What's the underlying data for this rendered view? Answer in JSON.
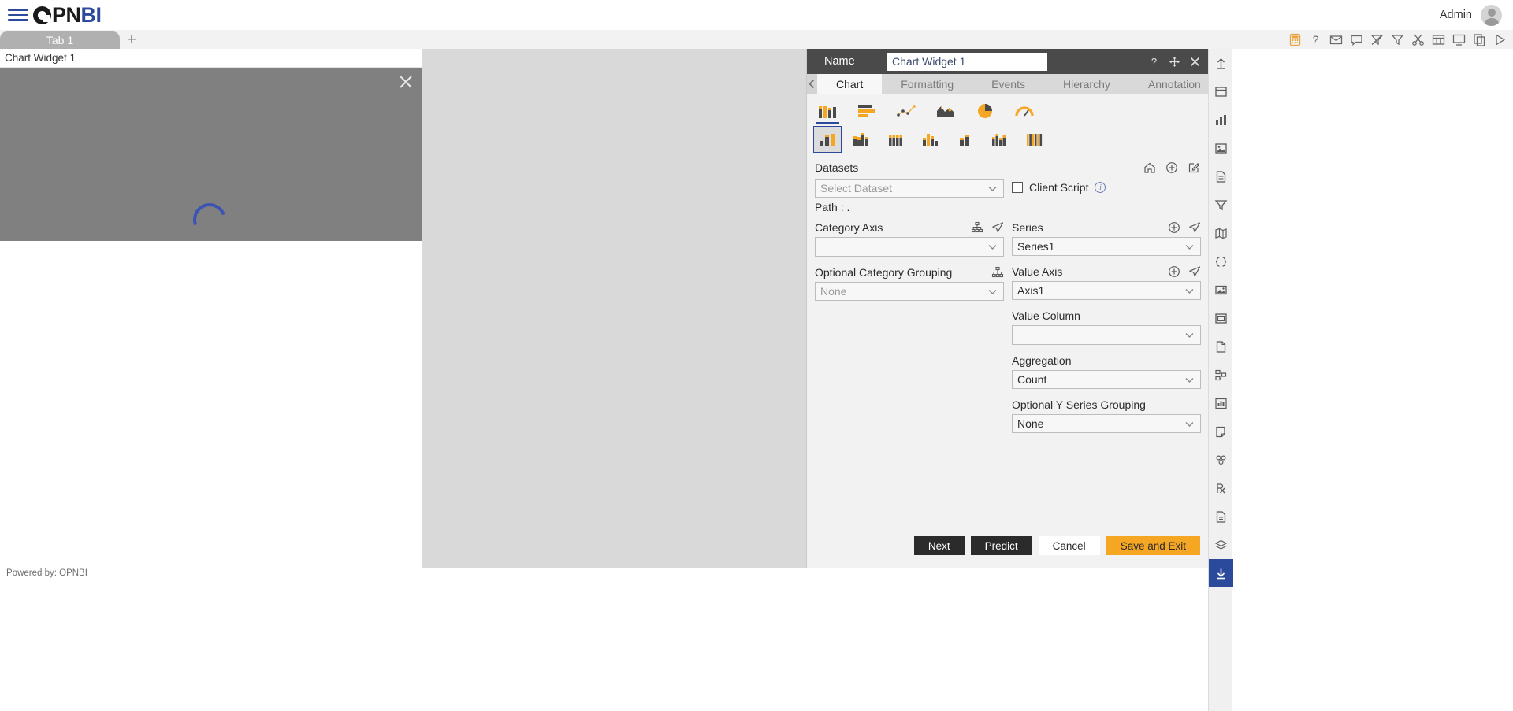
{
  "app": {
    "brand_mark": "O",
    "brand_pn": "PN",
    "brand_bi": "BI",
    "hamburger_icon": "hamburger-menu-icon",
    "admin_label": "Admin",
    "avatar_icon": "user-avatar-icon"
  },
  "tabstrip": {
    "tabs": [
      {
        "label": "Tab 1"
      }
    ],
    "add_tab_label": "+",
    "icons": [
      {
        "name": "calculator-icon",
        "glyph": "calc",
        "accent": true
      },
      {
        "name": "help-icon",
        "glyph": "question"
      },
      {
        "name": "mail-icon",
        "glyph": "mail"
      },
      {
        "name": "comment-icon",
        "glyph": "comment"
      },
      {
        "name": "filter-off-icon",
        "glyph": "filter-off"
      },
      {
        "name": "filter-icon",
        "glyph": "filter"
      },
      {
        "name": "scissors-icon",
        "glyph": "scissors"
      },
      {
        "name": "table-icon",
        "glyph": "table"
      },
      {
        "name": "presentation-icon",
        "glyph": "presentation"
      },
      {
        "name": "copy-icon",
        "glyph": "copy"
      },
      {
        "name": "play-icon",
        "glyph": "play"
      }
    ]
  },
  "widget": {
    "title": "Chart Widget 1",
    "close_icon": "close-icon",
    "loading_icon": "loading-spinner-icon"
  },
  "footer": {
    "powered_by": "Powered by: OPNBI"
  },
  "panel": {
    "name_label": "Name",
    "name_value": "Chart Widget 1",
    "header_icons": [
      {
        "name": "help-icon"
      },
      {
        "name": "move-icon"
      },
      {
        "name": "close-icon"
      }
    ],
    "tabs": [
      {
        "label": "Chart",
        "active": true
      },
      {
        "label": "Formatting",
        "active": false
      },
      {
        "label": "Events",
        "active": false
      },
      {
        "label": "Hierarchy",
        "active": false
      },
      {
        "label": "Annotation",
        "active": false
      }
    ],
    "nav_back_icon": "chevron-left-icon",
    "nav_forward_icon": "chevron-right-icon",
    "chart_types_row1": [
      {
        "name": "column-chart-icon",
        "selected": true
      },
      {
        "name": "bar-chart-icon",
        "selected": false
      },
      {
        "name": "scatter-chart-icon",
        "selected": false
      },
      {
        "name": "area-chart-icon",
        "selected": false
      },
      {
        "name": "pie-chart-icon",
        "selected": false
      },
      {
        "name": "gauge-chart-icon",
        "selected": false
      }
    ],
    "chart_types_row2": [
      {
        "name": "clustered-column-icon",
        "selected": true
      },
      {
        "name": "stacked-column-icon",
        "selected": false
      },
      {
        "name": "stacked-column-100-icon",
        "selected": false
      },
      {
        "name": "grouped-column-icon",
        "selected": false
      },
      {
        "name": "overlapped-column-icon",
        "selected": false
      },
      {
        "name": "multi-column-icon",
        "selected": false
      },
      {
        "name": "dense-column-icon",
        "selected": false
      }
    ],
    "datasets": {
      "label": "Datasets",
      "icons": [
        {
          "name": "home-icon"
        },
        {
          "name": "add-circle-icon"
        },
        {
          "name": "edit-icon"
        }
      ],
      "select_placeholder": "Select Dataset",
      "select_value": "",
      "path_label": "Path :  ."
    },
    "client_script": {
      "label": "Client Script",
      "checked": false,
      "info_icon": "info-icon",
      "info_glyph": "i"
    },
    "left_fields": [
      {
        "label": "Category Axis",
        "value": "",
        "placeholder": "",
        "icons": [
          {
            "name": "hierarchy-icon"
          },
          {
            "name": "send-icon"
          }
        ]
      },
      {
        "label": "Optional Category Grouping",
        "value": "None",
        "placeholder": "",
        "icons": [
          {
            "name": "hierarchy-icon"
          }
        ]
      }
    ],
    "right_fields": [
      {
        "label": "Series",
        "value": "Series1",
        "icons": [
          {
            "name": "add-circle-icon"
          },
          {
            "name": "send-icon"
          }
        ]
      },
      {
        "label": "Value Axis",
        "value": "Axis1",
        "icons": [
          {
            "name": "add-circle-icon"
          },
          {
            "name": "send-icon"
          }
        ]
      },
      {
        "label": "Value Column",
        "value": "",
        "icons": []
      },
      {
        "label": "Aggregation",
        "value": "Count",
        "icons": []
      },
      {
        "label": "Optional Y Series Grouping",
        "value": "None",
        "icons": []
      }
    ],
    "buttons": [
      {
        "label": "Next",
        "style": "dark"
      },
      {
        "label": "Predict",
        "style": "dark"
      },
      {
        "label": "Cancel",
        "style": "light"
      },
      {
        "label": "Save and Exit",
        "style": "amber"
      }
    ]
  },
  "rail": {
    "items": [
      {
        "name": "upload-icon",
        "accent": false
      },
      {
        "name": "layout-icon",
        "accent": false
      },
      {
        "name": "chart-bar-icon",
        "accent": false
      },
      {
        "name": "image-widget-icon",
        "accent": false
      },
      {
        "name": "document-icon",
        "accent": false
      },
      {
        "name": "filter-widget-icon",
        "accent": false
      },
      {
        "name": "map-icon",
        "accent": false
      },
      {
        "name": "code-icon",
        "accent": false
      },
      {
        "name": "picture-icon",
        "accent": false
      },
      {
        "name": "frame-icon",
        "accent": false
      },
      {
        "name": "page-icon",
        "accent": false
      },
      {
        "name": "tree-icon",
        "accent": false
      },
      {
        "name": "analytics-icon",
        "accent": false
      },
      {
        "name": "note-icon",
        "accent": false
      },
      {
        "name": "group-icon",
        "accent": false
      },
      {
        "name": "prescription-icon",
        "accent": false
      },
      {
        "name": "file-icon",
        "accent": false
      },
      {
        "name": "layers-icon",
        "accent": false
      },
      {
        "name": "download-icon",
        "accent": true
      }
    ]
  },
  "colors": {
    "accent_blue": "#2b4a9b",
    "amber": "#f5a623",
    "panel_header": "#4a4a4a",
    "canvas_gray": "#808080"
  }
}
